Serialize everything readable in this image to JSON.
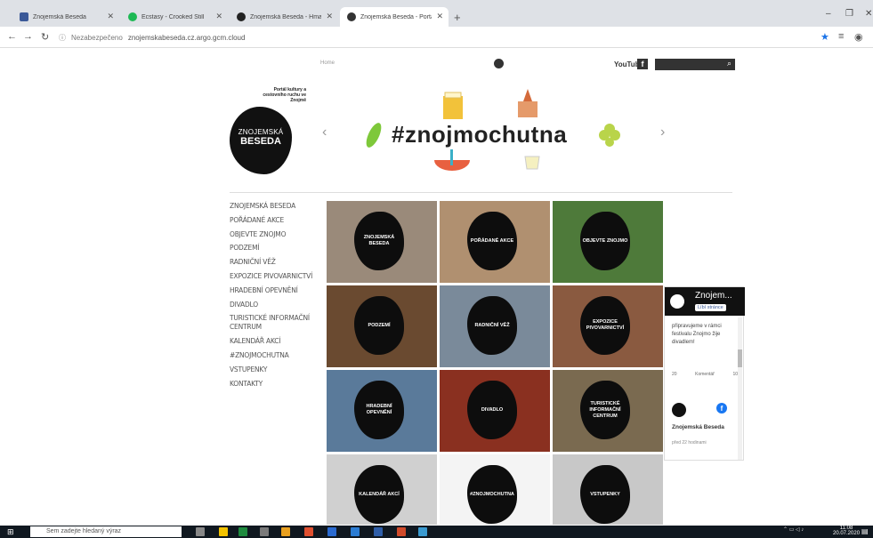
{
  "browser": {
    "tabs": [
      {
        "title": "Znojemská Beseda",
        "favicon_color": "#3b5998",
        "active": false
      },
      {
        "title": "Ecstasy - Crooked Still",
        "favicon_color": "#1db954",
        "active": false
      },
      {
        "title": "Znojemská Beseda - Hmaznádi…",
        "favicon_color": "#222222",
        "active": false
      },
      {
        "title": "Znojemská Beseda - Portál kultu…",
        "favicon_color": "#333333",
        "active": true
      }
    ],
    "security": "Nezabezpečeno",
    "url": "znojemskabeseda.cz.argo.gcm.cloud"
  },
  "header": {
    "top_links": "Home",
    "lang": "",
    "youtube": "YouTube",
    "fb_letter": "f"
  },
  "tagline": "Portál kultury a cestovního ruchu ve Znojmě",
  "logo": {
    "line1": "ZNOJEMSKÁ",
    "line2": "BESEDA"
  },
  "banner": {
    "hashtag": "#znojmochutna"
  },
  "menu": [
    "ZNOJEMSKÁ BESEDA",
    "POŘÁDANÉ AKCE",
    "OBJEVTE ZNOJMO",
    "PODZEMÍ",
    "RADNIČNÍ VĚŽ",
    "EXPOZICE PIVOVARNICTVÍ",
    "HRADEBNÍ OPEVNĚNÍ",
    "DIVADLO",
    "TURISTICKÉ INFORMAČNÍ CENTRUM",
    "KALENDÁŘ AKCÍ",
    "#ZNOJMOCHUTNA",
    "VSTUPENKY",
    "KONTAKTY"
  ],
  "tiles": [
    {
      "label": "ZNOJEMSKÁ BESEDA",
      "bg": "#9a8a7a"
    },
    {
      "label": "POŘÁDANÉ AKCE",
      "bg": "#b09070"
    },
    {
      "label": "OBJEVTE ZNOJMO",
      "bg": "#4e7a3a"
    },
    {
      "label": "PODZEMÍ",
      "bg": "#6a4a30"
    },
    {
      "label": "RADNIČNÍ VĚŽ",
      "bg": "#7a8a9a"
    },
    {
      "label": "EXPOZICE PIVOVARNICTVÍ",
      "bg": "#8a5a40"
    },
    {
      "label": "HRADEBNÍ OPEVNĚNÍ",
      "bg": "#5a7a9a"
    },
    {
      "label": "DIVADLO",
      "bg": "#8a3020"
    },
    {
      "label": "TURISTICKÉ INFORMAČNÍ CENTRUM",
      "bg": "#7a6a50"
    },
    {
      "label": "KALENDÁŘ AKCÍ",
      "bg": "#d0d0d0"
    },
    {
      "label": "#ZNOJMOCHUTNA",
      "bg": "#f4f4f4"
    },
    {
      "label": "VSTUPENKY",
      "bg": "#c8c8c8"
    }
  ],
  "fb_widget": {
    "name": "Znojem...",
    "like": "Líbí stránce",
    "post": "připravujeme v rámci festivalu Znojmo žije divadlem!",
    "likes": "20",
    "comments": "Komentář",
    "shares": "10",
    "page_name": "Znojemská Beseda",
    "time": "před 22 hodinami"
  },
  "taskbar": {
    "search": "Sem zadejte hledaný výraz",
    "time": "11:08",
    "date": "20.07.2020"
  }
}
